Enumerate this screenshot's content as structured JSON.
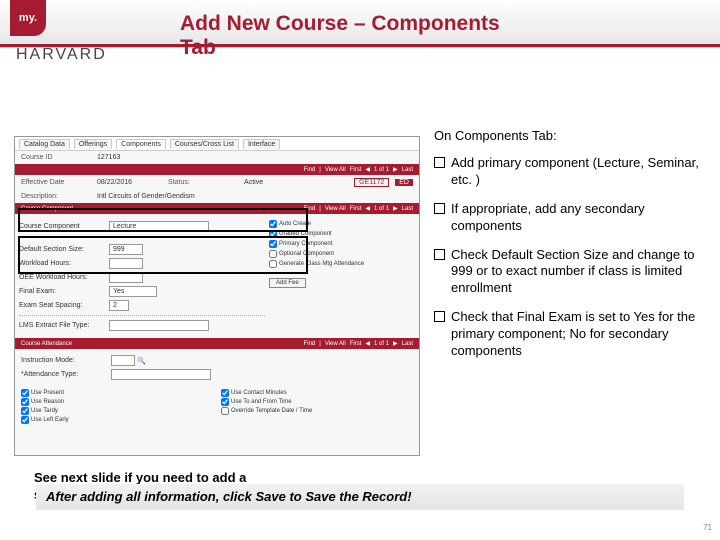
{
  "logo": {
    "my": "my.",
    "harvard": "HARVARD"
  },
  "title": "Add New Course – Components Tab",
  "screenshot": {
    "tabs": [
      "Catalog Data",
      "Offerings",
      "Components",
      "Courses/Cross List",
      "Interface"
    ],
    "activeTab": "Components",
    "courseId": {
      "label": "Course ID",
      "value": "127163"
    },
    "effDate": {
      "label": "Effective Date",
      "value": "08/22/2016"
    },
    "status": {
      "label": "Status:",
      "value": "Active"
    },
    "descript": {
      "label": "Description:",
      "value": "Intl Circuits of Gender/Gendism"
    },
    "idTag": "GE1172",
    "redTag": "ED",
    "nav": {
      "find": "Find",
      "viewAll": "View All",
      "first": "First",
      "last": "Last",
      "range": "1 of 1"
    },
    "rb1": "Course Component",
    "fields": {
      "courseComponent": {
        "label": "Course Component",
        "value": "Lecture"
      },
      "defaultSectionSize": {
        "label": "Default Section Size:",
        "value": "999"
      },
      "workloadHours": {
        "label": "Workload Hours:",
        "value": ""
      },
      "oeeWorkload": {
        "label": "OEE Workload Hours:",
        "value": ""
      },
      "finalExam": {
        "label": "Final Exam:",
        "value": "Yes"
      },
      "examSeat": {
        "label": "Exam Seat Spacing:",
        "value": "2"
      },
      "lmsFile": {
        "label": "LMS Extract File Type:",
        "value": ""
      }
    },
    "checks": {
      "autoCreate": {
        "label": "Auto Create",
        "checked": true
      },
      "graded": {
        "label": "Graded Component",
        "checked": true
      },
      "primary": {
        "label": "Primary Component",
        "checked": true
      },
      "optional": {
        "label": "Optional Component",
        "checked": false
      },
      "genAttend": {
        "label": "Generate Class Mtg Attendance",
        "checked": false
      }
    },
    "addFee": "Add Fee",
    "rb2": "Course Attendance",
    "attend": {
      "instrMode": {
        "label": "Instruction Mode:",
        "value": ""
      },
      "attendType": {
        "label": "*Attendance Type:",
        "value": ""
      },
      "usePresent": "Use Present",
      "useContactMin": "Use Contact Minutes",
      "useReason": "Use Reason",
      "useToFrom": "Use To and From Time",
      "useTardy": "Use Tardy",
      "overrideTpl": "Override Template Date / Time",
      "useLeftEarly": "Use Left Early"
    }
  },
  "side": {
    "heading": "On Components Tab:",
    "b1": "Add primary component (Lecture, Seminar, etc. )",
    "b2": "If appropriate, add any secondary components",
    "b3": "Check Default Section Size and change to 999 or to exact number if class is limited enrollment",
    "b4": "Check that Final Exam is set to Yes for the primary component; No for secondary components"
  },
  "note": "See next slide if you need to add a secondary component",
  "footer": "After adding all information, click Save to Save the Record!",
  "pageNum": "71"
}
